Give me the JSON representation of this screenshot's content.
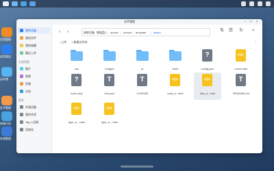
{
  "window": {
    "title": "文件管理"
  },
  "desktop": {
    "icons": [
      {
        "label": "应用管理",
        "color": "#f08a24"
      },
      {
        "label": "应用商店",
        "color": "#2f80ed"
      },
      {
        "label": "云存储",
        "color": "#56b4f3"
      },
      {
        "label": "证书管理",
        "color": "#f2994a"
      },
      {
        "label": "系统日志",
        "color": "#4aa3df"
      },
      {
        "label": "存储管理",
        "color": "#3e7bd6"
      }
    ]
  },
  "sidebar": {
    "items": [
      {
        "label": "我的设备",
        "icon": "device-icon",
        "color": "#2f80ed",
        "active": true
      },
      {
        "label": "我的文件",
        "icon": "folder-icon",
        "color": "#f0a33a"
      },
      {
        "label": "我的收藏",
        "icon": "star-icon",
        "color": "#f2c94c"
      },
      {
        "label": "最近上传",
        "icon": "upload-icon",
        "color": "#6fcf97"
      }
    ],
    "groups": [
      {
        "title": "分类视图",
        "items": [
          {
            "label": "图片",
            "icon": "image-icon",
            "color": "#56ccf2"
          },
          {
            "label": "视频",
            "icon": "video-icon",
            "color": "#bb6bd9"
          },
          {
            "label": "音频",
            "icon": "music-icon",
            "color": "#f2994a"
          },
          {
            "label": "文档",
            "icon": "document-icon",
            "color": "#2d9cdb"
          }
        ]
      },
      {
        "title": "更多",
        "items": [
          {
            "label": "外接设备",
            "icon": "usb-icon",
            "color": "#7a8290"
          },
          {
            "label": "我的共享",
            "icon": "share-icon",
            "color": "#7a8290"
          },
          {
            "label": "Tag 入回收",
            "icon": "tag-icon",
            "color": "#7a8290"
          },
          {
            "label": "回收站",
            "icon": "trash-icon",
            "color": "#7a8290"
          }
        ]
      }
    ]
  },
  "toolbar": {
    "breadcrumb": [
      "绿联设备",
      "数据盘1",
      "docker",
      "tomcat",
      "template",
      "iketau"
    ]
  },
  "actions": {
    "upload": "上传",
    "new_folder": "新建文件夹"
  },
  "files": [
    {
      "name": "css",
      "type": "folder"
    },
    {
      "name": "images",
      "type": "folder"
    },
    {
      "name": "js",
      "type": "folder"
    },
    {
      "name": "fonts",
      "type": "folder"
    },
    {
      "name": "config.json",
      "type": "unknown"
    },
    {
      "name": "icons.html",
      "type": "code"
    },
    {
      "name": "index.php",
      "type": "unknown"
    },
    {
      "name": "info.json",
      "type": "text"
    },
    {
      "name": "LICENSE",
      "type": "text"
    },
    {
      "name": "load_a...html",
      "type": "code"
    },
    {
      "name": "lists_a...html",
      "type": "code",
      "selected": true
    },
    {
      "name": "README.md",
      "type": "text"
    },
    {
      "name": "type_a....html",
      "type": "code"
    },
    {
      "name": "type_a....html",
      "type": "code"
    }
  ]
}
